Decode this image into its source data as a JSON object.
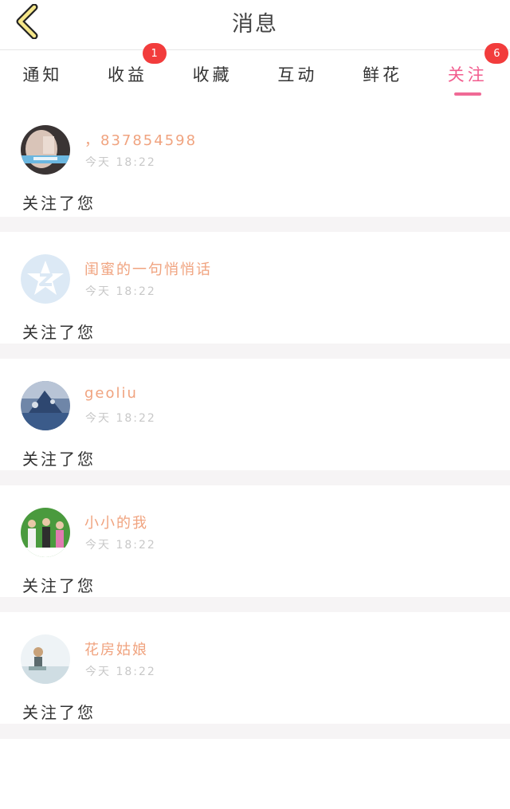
{
  "header": {
    "title": "消息"
  },
  "tabs": [
    {
      "label": "通知",
      "badge": null,
      "active": false
    },
    {
      "label": "收益",
      "badge": "1",
      "active": false
    },
    {
      "label": "收藏",
      "badge": null,
      "active": false
    },
    {
      "label": "互动",
      "badge": null,
      "active": false
    },
    {
      "label": "鲜花",
      "badge": null,
      "active": false
    },
    {
      "label": "关注",
      "badge": "6",
      "active": true
    }
  ],
  "notifications": [
    {
      "username": "，837854598",
      "time": "今天 18:22",
      "message": "关注了您",
      "avatar_icon": "user-photo-avatar"
    },
    {
      "username": "闺蜜的一句悄悄话",
      "time": "今天 18:22",
      "message": "关注了您",
      "avatar_icon": "qzone-star-avatar"
    },
    {
      "username": "geoliu",
      "time": "今天 18:22",
      "message": "关注了您",
      "avatar_icon": "user-photo-avatar"
    },
    {
      "username": "小小的我",
      "time": "今天 18:22",
      "message": "关注了您",
      "avatar_icon": "user-photo-avatar"
    },
    {
      "username": "花房姑娘",
      "time": "今天 18:22",
      "message": "关注了您",
      "avatar_icon": "user-photo-avatar"
    }
  ],
  "colors": {
    "accent": "#f06a96",
    "badge": "#f23c3c",
    "username": "#f0a37f",
    "separator": "#f6f4f5"
  }
}
